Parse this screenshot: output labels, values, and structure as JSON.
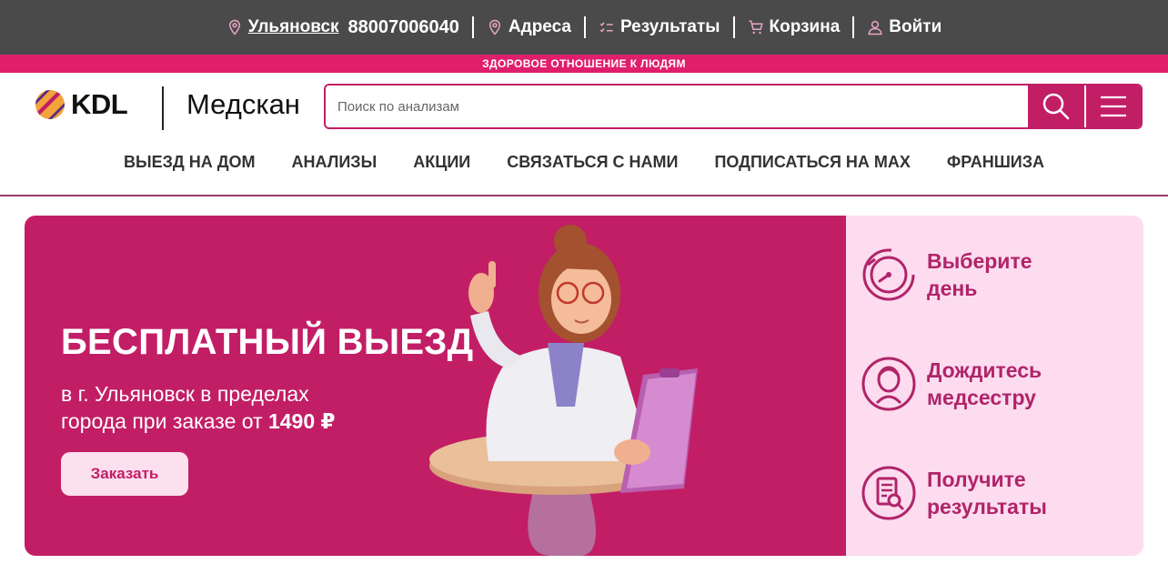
{
  "topbar": {
    "city": "Ульяновск",
    "phone": "88007006040",
    "addresses": "Адреса",
    "results": "Результаты",
    "cart": "Корзина",
    "login": "Войти"
  },
  "tagline": "ЗДОРОВОЕ ОТНОШЕНИЕ К ЛЮДЯМ",
  "logo": {
    "brand": "KDL",
    "partner": "Медскан"
  },
  "search": {
    "placeholder": "Поиск по анализам"
  },
  "nav": [
    {
      "label": "ВЫЕЗД НА ДОМ"
    },
    {
      "label": "АНАЛИЗЫ"
    },
    {
      "label": "АКЦИИ"
    },
    {
      "label": "СВЯЗАТЬСЯ С НАМИ"
    },
    {
      "label": "ПОДПИСАТЬСЯ НА MAX"
    },
    {
      "label": "ФРАНШИЗА"
    }
  ],
  "banner": {
    "title": "БЕСПЛАТНЫЙ ВЫЕЗД",
    "subtitle_line1": "в г. Ульяновск в пределах",
    "subtitle_line2": "города при заказе от ",
    "price": "1490 ₽",
    "order_button": "Заказать"
  },
  "steps": [
    {
      "line1": "Выберите",
      "line2": "день",
      "icon": "clock-icon"
    },
    {
      "line1": "Дождитесь",
      "line2": "медсестру",
      "icon": "nurse-icon"
    },
    {
      "line1": "Получите",
      "line2": "результаты",
      "icon": "document-search-icon"
    }
  ],
  "colors": {
    "accent": "#c21e66",
    "tagline": "#e01f6c",
    "topbar": "#4a4a4a",
    "steps_bg": "#fcdcee"
  }
}
